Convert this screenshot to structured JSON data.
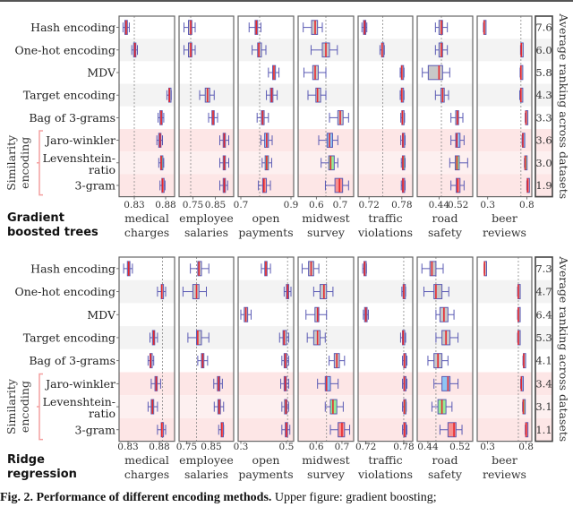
{
  "caption": {
    "bold": "Fig. 2. Performance of different encoding methods.",
    "rest": " Upper figure: gradient boosting;"
  },
  "rank_axis_label": "Average ranking across datasets",
  "group_label": [
    "Similarity",
    "encoding"
  ],
  "methods": [
    "Hash encoding",
    "One-hot encoding",
    "MDV",
    "Target encoding",
    "Bag of 3-grams",
    "Jaro-winkler",
    "Levenshtein-ratio",
    "3-gram"
  ],
  "method_labels": [
    [
      "Hash encoding"
    ],
    [
      "One-hot encoding"
    ],
    [
      "MDV"
    ],
    [
      "Target encoding"
    ],
    [
      "Bag of 3-grams"
    ],
    [
      "Jaro-winkler"
    ],
    [
      "Levenshtein-",
      "ratio"
    ],
    [
      "3-gram"
    ]
  ],
  "colors": {
    "box_default": "#c8c8c8",
    "box_jaro": "#8ec5f5",
    "box_lev": "#96eb96",
    "box_3gram": "#f7918f",
    "box_border": "#5a5ab4",
    "median": "#e8282d",
    "row_gray": "#f3f3f3",
    "row_pink": "#fde6e6",
    "row_pink_light": "#fdf0f0",
    "bracket": "#f4a0a0"
  },
  "chart_data": [
    {
      "type": "boxplot",
      "title": "Gradient boosted trees",
      "model_label": [
        "Gradient",
        "boosted trees"
      ],
      "datasets": [
        {
          "name": [
            "medical",
            "charges"
          ],
          "ticks": [
            0.83,
            0.88
          ],
          "xlim": [
            0.81,
            0.89
          ],
          "ref": 0.83,
          "boxes": [
            [
              0.812,
              0.815,
              0.817,
              0.819,
              0.822
            ],
            [
              0.826,
              0.829,
              0.831,
              0.832,
              0.835
            ],
            null,
            [
              0.882,
              0.885,
              0.886,
              0.887,
              0.889
            ],
            [
              0.868,
              0.871,
              0.873,
              0.874,
              0.877
            ],
            [
              0.866,
              0.869,
              0.871,
              0.872,
              0.875
            ],
            [
              0.869,
              0.872,
              0.873,
              0.874,
              0.877
            ],
            [
              0.871,
              0.874,
              0.875,
              0.876,
              0.879
            ]
          ]
        },
        {
          "name": [
            "employee",
            "salaries"
          ],
          "ticks": [
            0.75,
            0.85
          ],
          "xlim": [
            0.7,
            0.92
          ],
          "ref": 0.74,
          "boxes": [
            [
              0.71,
              0.73,
              0.74,
              0.745,
              0.76
            ],
            [
              0.71,
              0.73,
              0.74,
              0.745,
              0.76
            ],
            null,
            [
              0.78,
              0.805,
              0.815,
              0.825,
              0.845
            ],
            [
              0.82,
              0.835,
              0.84,
              0.845,
              0.86
            ],
            [
              0.87,
              0.885,
              0.89,
              0.895,
              0.91
            ],
            [
              0.87,
              0.885,
              0.89,
              0.895,
              0.91
            ],
            [
              0.87,
              0.885,
              0.89,
              0.895,
              0.905
            ]
          ]
        },
        {
          "name": [
            "open",
            "payments"
          ],
          "ticks": [
            0.7,
            0.9
          ],
          "xlim": [
            0.7,
            0.9
          ],
          "ref": 0.775,
          "boxes": [
            [
              0.733,
              0.757,
              0.762,
              0.767,
              0.78
            ],
            [
              0.745,
              0.767,
              0.772,
              0.782,
              0.8
            ],
            [
              0.81,
              0.827,
              0.832,
              0.838,
              0.852
            ],
            [
              0.802,
              0.818,
              0.823,
              0.828,
              0.845
            ],
            [
              0.765,
              0.782,
              0.787,
              0.793,
              0.81
            ],
            [
              0.78,
              0.795,
              0.803,
              0.81,
              0.825
            ],
            [
              0.785,
              0.797,
              0.803,
              0.81,
              0.823
            ],
            [
              0.77,
              0.787,
              0.792,
              0.802,
              0.818
            ]
          ]
        },
        {
          "name": [
            "midwest",
            "survey"
          ],
          "ticks": [
            0.6,
            0.7
          ],
          "xlim": [
            0.535,
            0.745
          ],
          "ref": 0.64,
          "boxes": [
            [
              0.545,
              0.58,
              0.595,
              0.605,
              0.625
            ],
            [
              0.578,
              0.625,
              0.64,
              0.655,
              0.688
            ],
            [
              0.548,
              0.585,
              0.595,
              0.608,
              0.64
            ],
            [
              0.565,
              0.598,
              0.605,
              0.618,
              0.64
            ],
            [
              0.655,
              0.69,
              0.7,
              0.712,
              0.735
            ],
            [
              0.61,
              0.645,
              0.655,
              0.668,
              0.69
            ],
            [
              0.62,
              0.652,
              0.66,
              0.675,
              0.69
            ],
            [
              0.638,
              0.678,
              0.697,
              0.71,
              0.735
            ]
          ]
        },
        {
          "name": [
            "traffic",
            "violations"
          ],
          "ticks": [
            0.72,
            0.78
          ],
          "xlim": [
            0.705,
            0.795
          ],
          "ref": 0.745,
          "boxes": [
            [
              0.707,
              0.71,
              0.712,
              0.713,
              0.716
            ],
            [
              0.74,
              0.743,
              0.744,
              0.745,
              0.748
            ],
            [
              0.777,
              0.779,
              0.78,
              0.781,
              0.784
            ],
            [
              0.777,
              0.779,
              0.78,
              0.782,
              0.784
            ],
            [
              0.778,
              0.78,
              0.781,
              0.782,
              0.785
            ],
            [
              0.778,
              0.781,
              0.782,
              0.783,
              0.786
            ],
            [
              0.779,
              0.781,
              0.782,
              0.783,
              0.786
            ],
            [
              0.779,
              0.781,
              0.782,
              0.783,
              0.786
            ]
          ]
        },
        {
          "name": [
            "road",
            "safety"
          ],
          "ticks": [
            0.44,
            0.52
          ],
          "xlim": [
            0.36,
            0.57
          ],
          "ref": 0.45,
          "boxes": [
            [
              0.425,
              0.44,
              0.45,
              0.455,
              0.475
            ],
            [
              0.425,
              0.44,
              0.45,
              0.455,
              0.475
            ],
            [
              0.37,
              0.395,
              0.44,
              0.455,
              0.485
            ],
            [
              0.425,
              0.448,
              0.455,
              0.462,
              0.48
            ],
            [
              0.49,
              0.51,
              0.517,
              0.522,
              0.54
            ],
            [
              0.49,
              0.51,
              0.515,
              0.528,
              0.545
            ],
            [
              0.485,
              0.508,
              0.515,
              0.525,
              0.56
            ],
            [
              0.49,
              0.512,
              0.518,
              0.528,
              0.545
            ]
          ]
        },
        {
          "name": [
            "beer",
            "reviews"
          ],
          "ticks": [
            0.3,
            0.8
          ],
          "xlim": [
            0.2,
            0.83
          ],
          "ref": 0.725,
          "boxes": [
            [
              0.245,
              0.25,
              0.255,
              0.26,
              0.265
            ],
            [
              0.72,
              0.725,
              0.73,
              0.735,
              0.74
            ],
            [
              0.715,
              0.72,
              0.725,
              0.73,
              0.735
            ],
            [
              0.71,
              0.72,
              0.725,
              0.73,
              0.735
            ],
            [
              0.78,
              0.785,
              0.79,
              0.795,
              0.8
            ],
            [
              0.74,
              0.745,
              0.75,
              0.755,
              0.76
            ],
            [
              0.77,
              0.775,
              0.78,
              0.785,
              0.79
            ],
            [
              0.8,
              0.805,
              0.81,
              0.815,
              0.82
            ]
          ]
        }
      ],
      "rankings": [
        "7.6",
        "6.0",
        "5.8",
        "4.3",
        "3.3",
        "3.6",
        "3.0",
        "1.9"
      ]
    },
    {
      "type": "boxplot",
      "title": "Ridge regression",
      "model_label": [
        "Ridge",
        "regression"
      ],
      "datasets": [
        {
          "name": [
            "medical",
            "charges"
          ],
          "ticks": [
            0.83,
            0.88
          ],
          "xlim": [
            0.82,
            0.9
          ],
          "ref": 0.885,
          "boxes": [
            [
              0.823,
              0.829,
              0.831,
              0.833,
              0.837
            ],
            [
              0.877,
              0.883,
              0.884,
              0.886,
              0.89
            ],
            null,
            [
              0.865,
              0.869,
              0.871,
              0.872,
              0.877
            ],
            [
              0.862,
              0.865,
              0.866,
              0.867,
              0.871
            ],
            [
              0.867,
              0.873,
              0.875,
              0.876,
              0.882
            ],
            [
              0.862,
              0.867,
              0.869,
              0.871,
              0.877
            ],
            [
              0.877,
              0.883,
              0.884,
              0.886,
              0.89
            ]
          ]
        },
        {
          "name": [
            "employee",
            "salaries"
          ],
          "ticks": [
            0.75,
            0.85
          ],
          "xlim": [
            0.73,
            0.93
          ],
          "ref": 0.79,
          "boxes": [
            [
              0.765,
              0.795,
              0.8,
              0.81,
              0.84
            ],
            [
              0.735,
              0.775,
              0.79,
              0.8,
              0.83
            ],
            null,
            [
              0.755,
              0.79,
              0.795,
              0.81,
              0.84
            ],
            [
              0.795,
              0.81,
              0.815,
              0.82,
              0.835
            ],
            [
              0.86,
              0.875,
              0.88,
              0.885,
              0.895
            ],
            [
              0.862,
              0.877,
              0.882,
              0.887,
              0.9
            ],
            [
              0.88,
              0.89,
              0.893,
              0.895,
              0.9
            ]
          ]
        },
        {
          "name": [
            "open",
            "payments"
          ],
          "ticks": [
            0.3,
            0.5
          ],
          "xlim": [
            0.3,
            0.52
          ],
          "ref": 0.505,
          "boxes": [
            [
              0.39,
              0.405,
              0.41,
              0.415,
              0.43
            ],
            [
              0.49,
              0.5,
              0.505,
              0.51,
              0.52
            ],
            [
              0.3,
              0.315,
              0.322,
              0.33,
              0.345
            ],
            [
              0.47,
              0.485,
              0.49,
              0.5,
              0.51
            ],
            [
              0.48,
              0.49,
              0.495,
              0.502,
              0.51
            ],
            [
              0.475,
              0.49,
              0.495,
              0.5,
              0.51
            ],
            [
              0.48,
              0.492,
              0.498,
              0.502,
              0.51
            ],
            [
              0.48,
              0.495,
              0.5,
              0.505,
              0.515
            ]
          ]
        },
        {
          "name": [
            "midwest",
            "survey"
          ],
          "ticks": [
            0.6,
            0.7
          ],
          "xlim": [
            0.54,
            0.735
          ],
          "ref": 0.64,
          "boxes": [
            [
              0.545,
              0.57,
              0.58,
              0.59,
              0.61
            ],
            [
              0.59,
              0.615,
              0.63,
              0.64,
              0.665
            ],
            [
              0.56,
              0.595,
              0.605,
              0.61,
              0.64
            ],
            [
              0.565,
              0.59,
              0.605,
              0.615,
              0.635
            ],
            [
              0.65,
              0.67,
              0.68,
              0.69,
              0.71
            ],
            [
              0.605,
              0.635,
              0.64,
              0.655,
              0.685
            ],
            [
              0.635,
              0.655,
              0.665,
              0.68,
              0.705
            ],
            [
              0.655,
              0.685,
              0.7,
              0.71,
              0.73
            ]
          ]
        },
        {
          "name": [
            "traffic",
            "violations"
          ],
          "ticks": [
            0.72,
            0.78
          ],
          "xlim": [
            0.712,
            0.79
          ],
          "ref": 0.78,
          "boxes": [
            [
              0.715,
              0.717,
              0.718,
              0.719,
              0.721
            ],
            [
              0.777,
              0.779,
              0.78,
              0.781,
              0.783
            ],
            [
              0.716,
              0.718,
              0.72,
              0.722,
              0.724
            ],
            [
              0.775,
              0.778,
              0.779,
              0.78,
              0.783
            ],
            [
              0.778,
              0.78,
              0.781,
              0.782,
              0.785
            ],
            [
              0.778,
              0.78,
              0.781,
              0.782,
              0.785
            ],
            [
              0.778,
              0.78,
              0.781,
              0.782,
              0.784
            ],
            [
              0.778,
              0.78,
              0.781,
              0.783,
              0.785
            ]
          ]
        },
        {
          "name": [
            "road",
            "safety"
          ],
          "ticks": [
            0.44,
            0.52
          ],
          "xlim": [
            0.42,
            0.545
          ],
          "ref": 0.46,
          "boxes": [
            [
              0.425,
              0.445,
              0.45,
              0.46,
              0.478
            ],
            [
              0.43,
              0.455,
              0.46,
              0.475,
              0.492
            ],
            [
              0.46,
              0.47,
              0.48,
              0.49,
              0.505
            ],
            [
              0.46,
              0.475,
              0.485,
              0.495,
              0.515
            ],
            [
              0.44,
              0.455,
              0.465,
              0.475,
              0.49
            ],
            [
              0.455,
              0.475,
              0.49,
              0.495,
              0.515
            ],
            [
              0.45,
              0.465,
              0.475,
              0.485,
              0.5
            ],
            [
              0.47,
              0.49,
              0.505,
              0.51,
              0.525
            ]
          ]
        },
        {
          "name": [
            "beer",
            "reviews"
          ],
          "ticks": [
            0.3,
            0.8
          ],
          "xlim": [
            0.2,
            0.84
          ],
          "ref": 0.7,
          "boxes": [
            [
              0.255,
              0.258,
              0.26,
              0.262,
              0.265
            ],
            [
              0.69,
              0.695,
              0.7,
              0.705,
              0.71
            ],
            [
              0.69,
              0.695,
              0.7,
              0.705,
              0.71
            ],
            [
              0.69,
              0.695,
              0.7,
              0.705,
              0.71
            ],
            [
              0.76,
              0.765,
              0.77,
              0.775,
              0.78
            ],
            [
              0.73,
              0.735,
              0.74,
              0.745,
              0.75
            ],
            [
              0.755,
              0.76,
              0.765,
              0.77,
              0.775
            ],
            [
              0.79,
              0.795,
              0.8,
              0.805,
              0.81
            ]
          ]
        }
      ],
      "rankings": [
        "7.3",
        "4.7",
        "6.4",
        "5.3",
        "4.1",
        "3.4",
        "3.1",
        "1.1"
      ]
    }
  ]
}
